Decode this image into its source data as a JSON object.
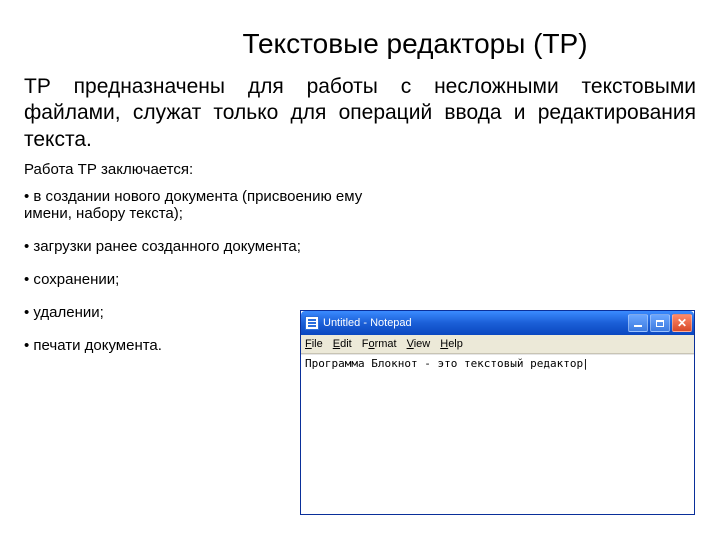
{
  "title": "Текстовые редакторы (ТР)",
  "intro": "ТР предназначены для работы с несложными текстовыми файлами, служат только для операций ввода и редактирования текста.",
  "sub": "Работа ТР заключается:",
  "bullets": [
    "• в создании нового документа (присвоению ему имени, набору текста);",
    "• загрузки ранее созданного документа;",
    "• сохранении;",
    "• удалении;",
    "• печати документа."
  ],
  "notepad": {
    "title": "Untitled - Notepad",
    "menu": {
      "file": "File",
      "edit": "Edit",
      "format": "Format",
      "view": "View",
      "help": "Help"
    },
    "content": "Программа Блокнот - это текстовый редактор"
  }
}
